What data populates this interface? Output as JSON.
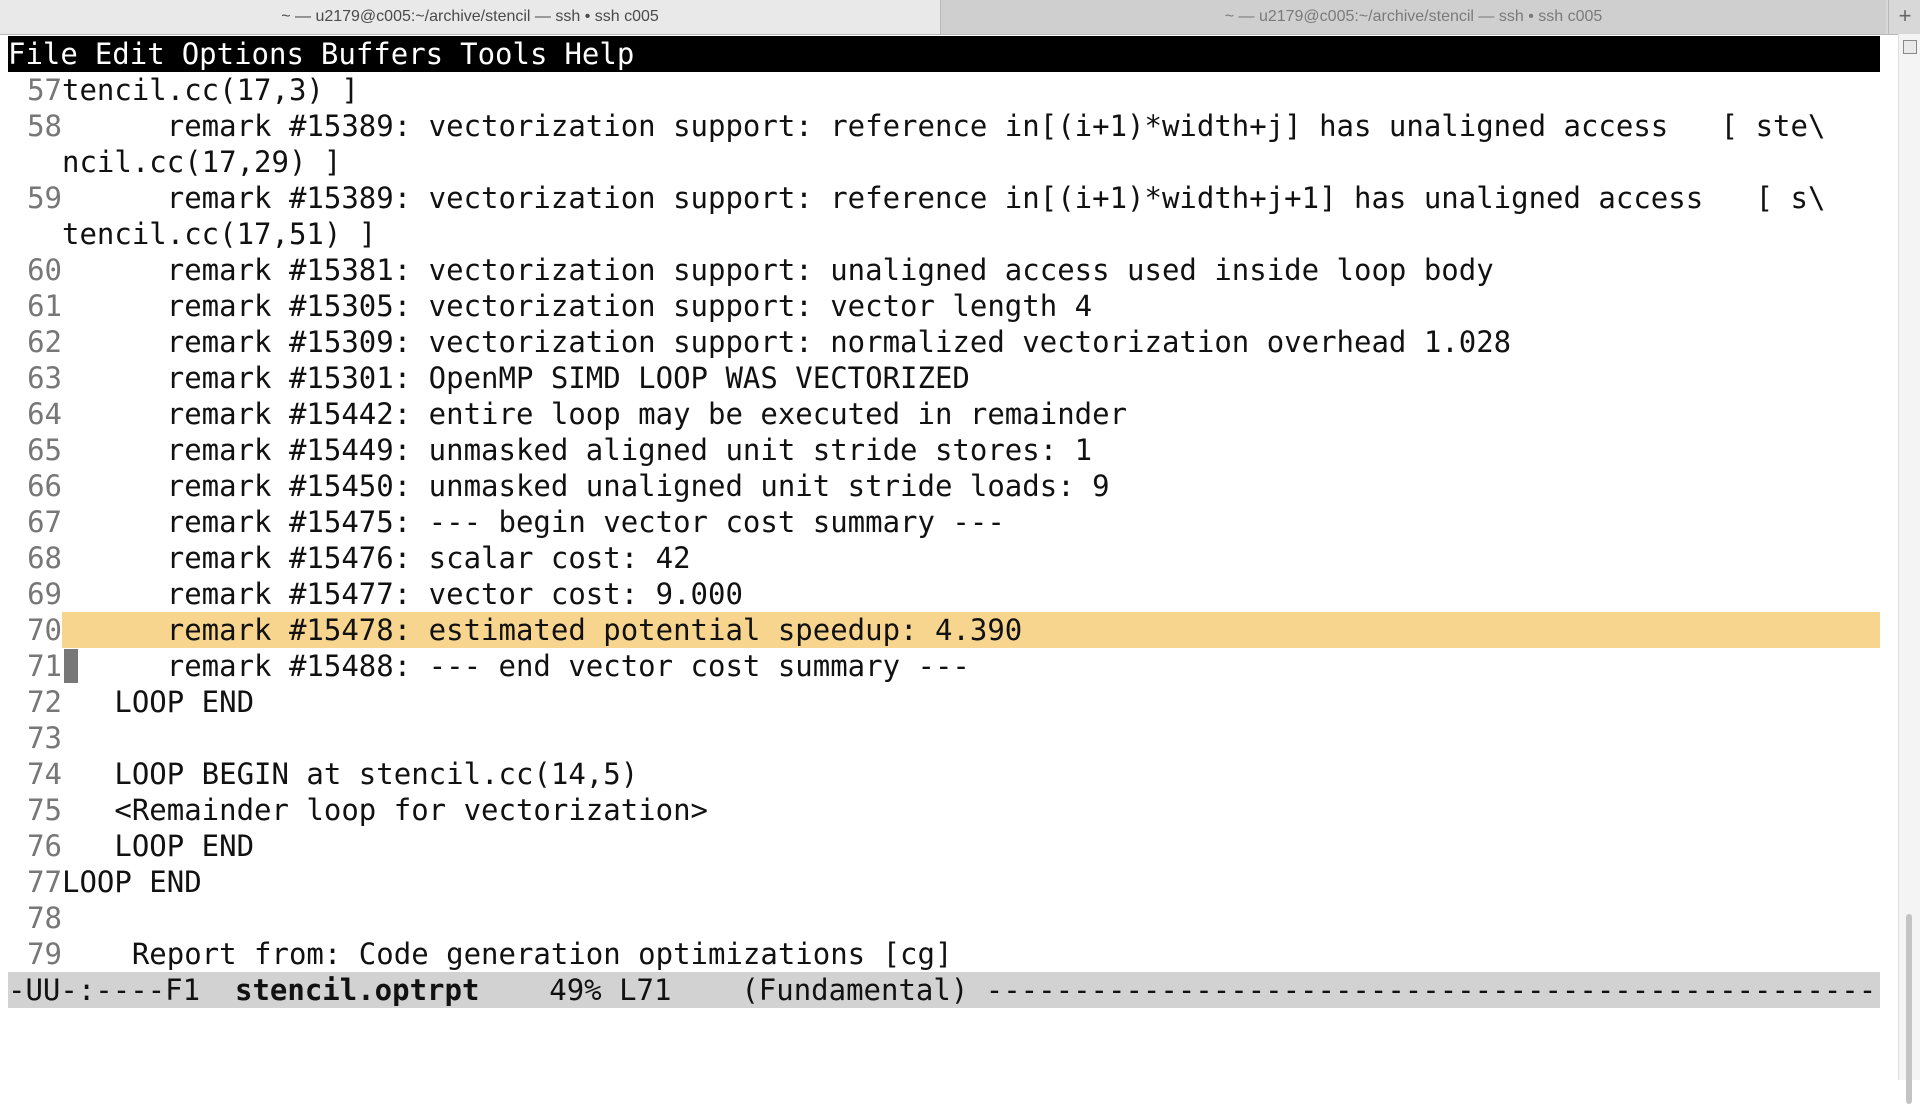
{
  "tabs": [
    {
      "label": "~ — u2179@c005:~/archive/stencil — ssh • ssh c005"
    },
    {
      "label": "~ — u2179@c005:~/archive/stencil — ssh • ssh c005"
    }
  ],
  "new_tab_symbol": "+",
  "menu": [
    "File",
    "Edit",
    "Options",
    "Buffers",
    "Tools",
    "Help"
  ],
  "lines": [
    {
      "num": "57",
      "text": "tencil.cc(17,3) ]"
    },
    {
      "num": "58",
      "text": "      remark #15389: vectorization support: reference in[(i+1)*width+j] has unaligned access   [ ste\\",
      "cont": "ncil.cc(17,29) ]"
    },
    {
      "num": "59",
      "text": "      remark #15389: vectorization support: reference in[(i+1)*width+j+1] has unaligned access   [ s\\",
      "cont": "tencil.cc(17,51) ]"
    },
    {
      "num": "60",
      "text": "      remark #15381: vectorization support: unaligned access used inside loop body"
    },
    {
      "num": "61",
      "text": "      remark #15305: vectorization support: vector length 4"
    },
    {
      "num": "62",
      "text": "      remark #15309: vectorization support: normalized vectorization overhead 1.028"
    },
    {
      "num": "63",
      "text": "      remark #15301: OpenMP SIMD LOOP WAS VECTORIZED"
    },
    {
      "num": "64",
      "text": "      remark #15442: entire loop may be executed in remainder"
    },
    {
      "num": "65",
      "text": "      remark #15449: unmasked aligned unit stride stores: 1"
    },
    {
      "num": "66",
      "text": "      remark #15450: unmasked unaligned unit stride loads: 9"
    },
    {
      "num": "67",
      "text": "      remark #15475: --- begin vector cost summary ---"
    },
    {
      "num": "68",
      "text": "      remark #15476: scalar cost: 42"
    },
    {
      "num": "69",
      "text": "      remark #15477: vector cost: 9.000"
    },
    {
      "num": "70",
      "text": "      remark #15478: estimated potential speedup: 4.390"
    },
    {
      "num": "71",
      "text": "      remark #15488: --- end vector cost summary ---"
    },
    {
      "num": "72",
      "text": "   LOOP END"
    },
    {
      "num": "73",
      "text": ""
    },
    {
      "num": "74",
      "text": "   LOOP BEGIN at stencil.cc(14,5)"
    },
    {
      "num": "75",
      "text": "   <Remainder loop for vectorization>"
    },
    {
      "num": "76",
      "text": "   LOOP END"
    },
    {
      "num": "77",
      "text": "LOOP END"
    },
    {
      "num": "78",
      "text": ""
    },
    {
      "num": "79",
      "text": "    Report from: Code generation optimizations [cg]"
    }
  ],
  "highlight_line": "70",
  "cursor_line": "71",
  "modeline": {
    "prefix": "-UU-:----F1  ",
    "buffer": "stencil.optrpt",
    "position": "    49% L71    ",
    "mode": "(Fundamental) ",
    "fill": "-----------------------------------------------------"
  },
  "colors": {
    "highlight": "#f7d58e",
    "menubar": "#000000",
    "modeline": "#d2d2d2"
  }
}
